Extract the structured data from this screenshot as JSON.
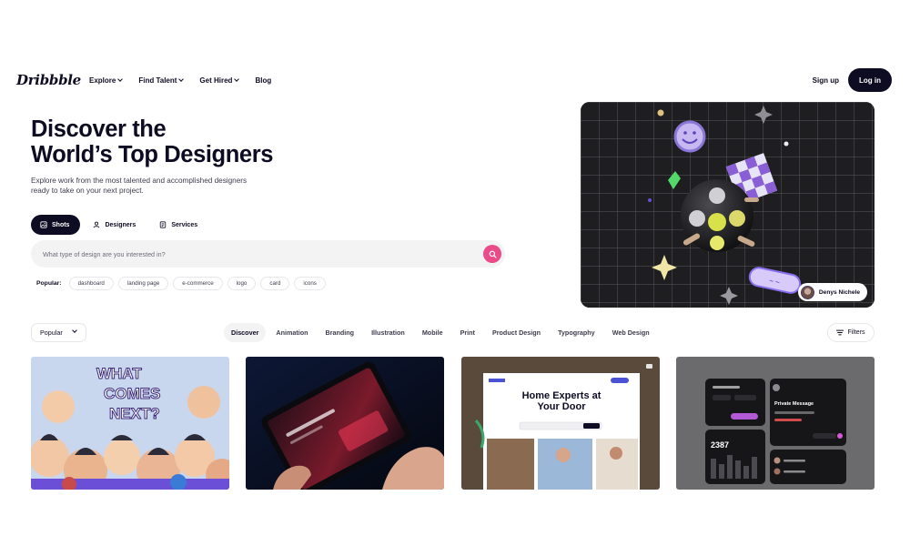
{
  "brand": {
    "logo": "Dribbble"
  },
  "nav": {
    "links": [
      {
        "label": "Explore",
        "has_menu": true
      },
      {
        "label": "Find Talent",
        "has_menu": true
      },
      {
        "label": "Get Hired",
        "has_menu": true
      },
      {
        "label": "Blog",
        "has_menu": false
      }
    ],
    "signup": "Sign up",
    "login": "Log in"
  },
  "hero": {
    "title_line1": "Discover the",
    "title_line2": "World’s Top Designers",
    "subtitle": "Explore work from the most talented and accomplished designers ready to take on your next project.",
    "segments": [
      {
        "label": "Shots",
        "icon": "image-icon",
        "active": true
      },
      {
        "label": "Designers",
        "icon": "user-icon",
        "active": false
      },
      {
        "label": "Services",
        "icon": "document-icon",
        "active": false
      }
    ],
    "search_placeholder": "What type of design are you interested in?",
    "popular_label": "Popular:",
    "popular_tags": [
      "dashboard",
      "landing page",
      "e-commerce",
      "logo",
      "card",
      "icons"
    ],
    "image_credit": "Denys Nichele"
  },
  "filter_bar": {
    "sort_selected": "Popular",
    "categories": [
      "Discover",
      "Animation",
      "Branding",
      "Illustration",
      "Mobile",
      "Print",
      "Product Design",
      "Typography",
      "Web Design"
    ],
    "active_category": "Discover",
    "filters_label": "Filters"
  },
  "shots": [
    {
      "name": "comic-illustration-shot",
      "caption": "WHAT COMES NEXT?"
    },
    {
      "name": "tablet-app-shot",
      "caption": "Passport Youth"
    },
    {
      "name": "home-experts-landing-shot",
      "caption": "Home Experts at Your Door"
    },
    {
      "name": "dashboard-dark-ui-shot",
      "caption": "Private Message",
      "stat": "2387"
    }
  ],
  "colors": {
    "accent": "#ea4c89",
    "dark": "#0d0c22",
    "muted": "#6e6d7a",
    "chip_bg": "#f3f3f4"
  }
}
